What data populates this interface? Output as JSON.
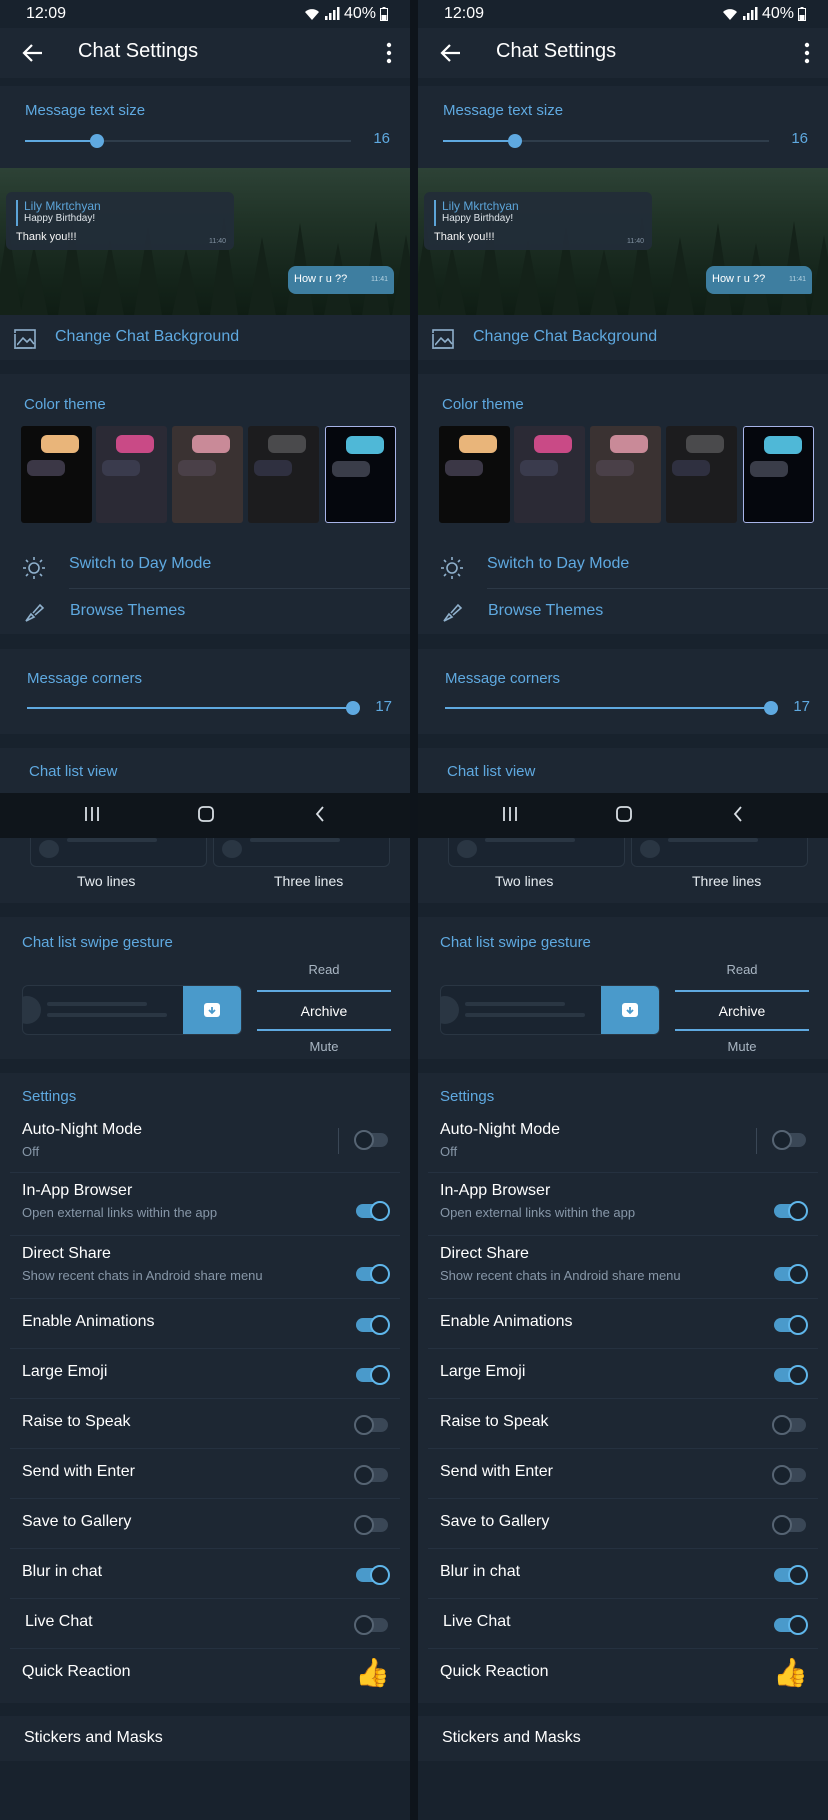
{
  "status": {
    "time": "12:09",
    "battery": "40%"
  },
  "header": {
    "title": "Chat Settings"
  },
  "text_size": {
    "label": "Message text size",
    "value": "16",
    "level": 0.22
  },
  "preview": {
    "sender": "Lily Mkrtchyan",
    "reply_text": "Happy Birthday!",
    "incoming_text": "Thank you!!!",
    "incoming_time": "11:40",
    "outgoing_text": "How r u ??",
    "outgoing_time": "11:41"
  },
  "background_link": {
    "label": "Change Chat Background"
  },
  "color_theme": {
    "label": "Color theme",
    "themes": [
      {
        "bg": "#0b0b0b",
        "b1": "#e9b57a",
        "b2": "#3b3746"
      },
      {
        "bg": "#2b2a35",
        "b1": "#c94a86",
        "b2": "#3a3b4d"
      },
      {
        "bg": "#3a3232",
        "b1": "#c98a98",
        "b2": "#4a4048"
      },
      {
        "bg": "#1c1c1e",
        "b1": "#4a4a4c",
        "b2": "#2f3040"
      },
      {
        "bg": "#05070d",
        "b1": "#4fb8d7",
        "b2": "#3a3d49"
      }
    ],
    "day_mode": "Switch to Day Mode",
    "browse": "Browse Themes"
  },
  "corners": {
    "label": "Message corners",
    "value": "17",
    "level": 1.0
  },
  "chat_list_view": {
    "label": "Chat list view",
    "options": [
      "Two lines",
      "Three lines"
    ]
  },
  "swipe": {
    "label": "Chat list swipe gesture",
    "options": [
      "Read",
      "Archive",
      "Mute"
    ],
    "selected": "Archive"
  },
  "settings_label": "Settings",
  "settings_rows": [
    {
      "title": "Auto-Night Mode",
      "subtitle": "Off"
    },
    {
      "title": "In-App Browser",
      "subtitle": "Open external links within the app"
    },
    {
      "title": "Direct Share",
      "subtitle": "Show recent chats in Android share menu"
    },
    {
      "title": "Enable Animations"
    },
    {
      "title": "Large Emoji"
    },
    {
      "title": "Raise to Speak"
    },
    {
      "title": "Send with Enter"
    },
    {
      "title": "Save to Gallery"
    },
    {
      "title": "Blur in chat"
    },
    {
      "title": "Live Chat"
    },
    {
      "title": "Quick Reaction",
      "emoji": "👍"
    }
  ],
  "left_states": [
    false,
    true,
    true,
    true,
    true,
    false,
    false,
    false,
    true,
    false
  ],
  "right_states": [
    false,
    true,
    true,
    true,
    true,
    false,
    false,
    false,
    true,
    true
  ],
  "stickers": "Stickers and Masks",
  "colors": {
    "accent": "#5fa9e0",
    "background": "#18222d",
    "card": "#1d2733"
  }
}
